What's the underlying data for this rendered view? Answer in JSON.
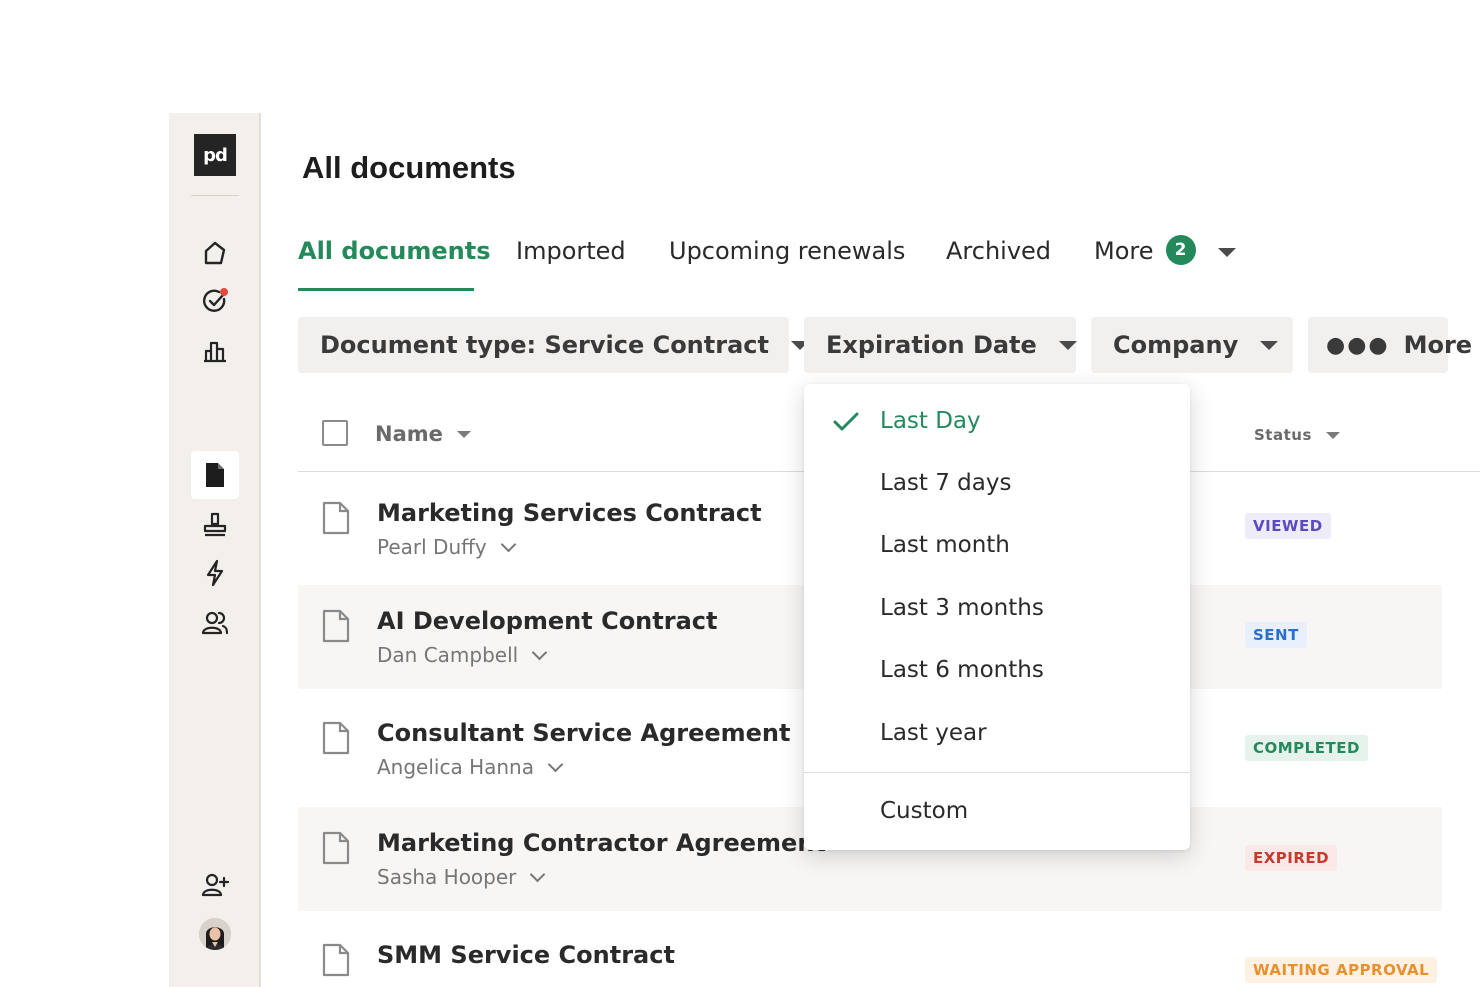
{
  "sidebar": {
    "logo": "pd",
    "icons": [
      "home-icon",
      "tasks-icon",
      "reports-icon",
      "documents-icon",
      "stamp-icon",
      "automation-icon",
      "contacts-icon",
      "add-user-icon"
    ]
  },
  "page_title": "All documents",
  "tabs": [
    {
      "label": "All documents",
      "active": true
    },
    {
      "label": "Imported"
    },
    {
      "label": "Upcoming renewals"
    },
    {
      "label": "Archived"
    },
    {
      "label": "More",
      "badge": "2"
    }
  ],
  "filters": {
    "document_type": "Document type: Service Contract",
    "expiration_date": "Expiration Date",
    "company": "Company",
    "more": "More"
  },
  "table": {
    "columns": {
      "name": "Name",
      "status": "Status"
    },
    "rows": [
      {
        "name": "Marketing Services Contract",
        "owner": "Pearl Duffy",
        "status": "VIEWED",
        "status_color": "#5b4bbf",
        "status_bg": "#efecf9"
      },
      {
        "name": "AI Development Contract",
        "owner": "Dan Campbell",
        "status": "SENT",
        "status_color": "#2a6fc9",
        "status_bg": "#e8f0fb"
      },
      {
        "name": "Consultant Service Agreement",
        "owner": "Angelica Hanna",
        "status": "COMPLETED",
        "status_color": "#248a5c",
        "status_bg": "#e6f3ec"
      },
      {
        "name": "Marketing Contractor Agreement",
        "owner": "Sasha Hooper",
        "status": "EXPIRED",
        "status_color": "#c43a31",
        "status_bg": "#fbe9e7"
      },
      {
        "name": "SMM Service Contract",
        "owner": "",
        "status": "WAITING APPROVAL",
        "status_color": "#e8902e",
        "status_bg": "#fdf1e3"
      }
    ]
  },
  "dropdown": {
    "options": [
      "Last Day",
      "Last 7 days",
      "Last month",
      "Last 3 months",
      "Last 6 months",
      "Last year"
    ],
    "selected_index": 0,
    "custom": "Custom"
  },
  "colors": {
    "accent": "#248a5c"
  }
}
